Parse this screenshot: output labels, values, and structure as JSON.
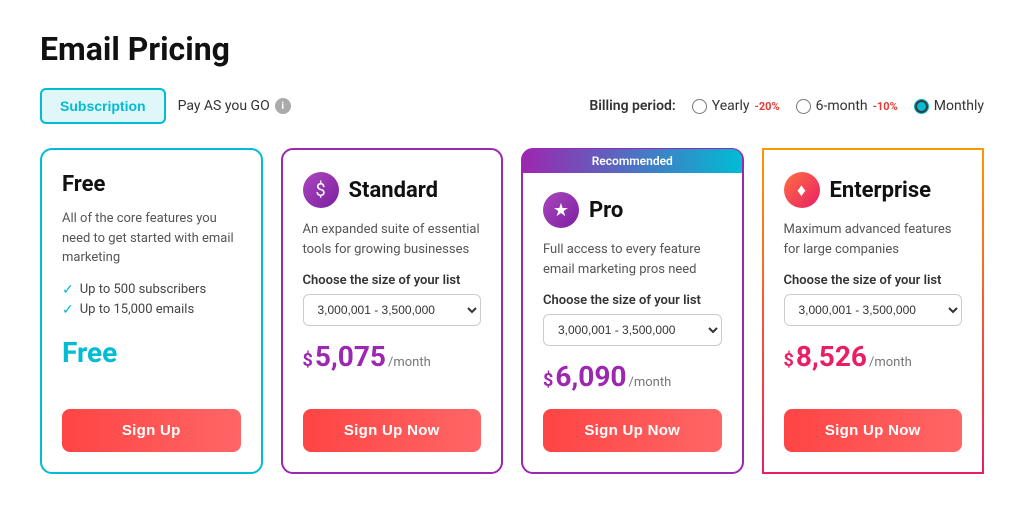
{
  "page": {
    "title": "Email Pricing",
    "background": "#fff"
  },
  "controls": {
    "subscription_label": "Subscription",
    "pay_as_go_label": "Pay AS you GO",
    "billing_label": "Billing period:",
    "billing_options": [
      {
        "id": "yearly",
        "label": "Yearly",
        "discount": "-20%",
        "selected": false
      },
      {
        "id": "6month",
        "label": "6-month",
        "discount": "-10%",
        "selected": false
      },
      {
        "id": "monthly",
        "label": "Monthly",
        "discount": "",
        "selected": true
      }
    ]
  },
  "cards": [
    {
      "id": "free",
      "title": "Free",
      "icon": null,
      "description": "All of the core features you need to get started with email marketing",
      "features": [
        "Up to 500 subscribers",
        "Up to 15,000 emails"
      ],
      "price_type": "free",
      "price_label": "Free",
      "has_list_selector": false,
      "list_value": null,
      "cta_label": "Sign Up",
      "recommended": false
    },
    {
      "id": "standard",
      "title": "Standard",
      "icon": "$",
      "description": "An expanded suite of essential tools for growing businesses",
      "features": [],
      "price_type": "paid",
      "price_amount": "5,075",
      "price_period": "/month",
      "has_list_selector": true,
      "list_label": "Choose the size of your list",
      "list_value": "3,000,001 - 3,500,000",
      "cta_label": "Sign Up Now",
      "recommended": false
    },
    {
      "id": "pro",
      "title": "Pro",
      "icon": "★",
      "description": "Full access to every feature email marketing pros need",
      "features": [],
      "price_type": "paid",
      "price_amount": "6,090",
      "price_period": "/month",
      "has_list_selector": true,
      "list_label": "Choose the size of your list",
      "list_value": "3,000,001 - 3,500,000",
      "cta_label": "Sign Up Now",
      "recommended": true,
      "recommended_label": "Recommended"
    },
    {
      "id": "enterprise",
      "title": "Enterprise",
      "icon": "♦",
      "description": "Maximum advanced features for large companies",
      "features": [],
      "price_type": "paid_enterprise",
      "price_amount": "8,526",
      "price_period": "/month",
      "has_list_selector": true,
      "list_label": "Choose the size of your list",
      "list_value": "3,000,001 - 3,500,000",
      "cta_label": "Sign Up Now",
      "recommended": false
    }
  ]
}
